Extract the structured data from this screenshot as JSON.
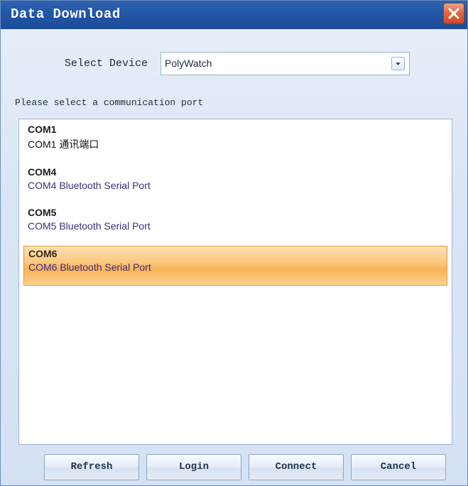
{
  "window": {
    "title": "Data Download"
  },
  "device": {
    "label": "Select Device",
    "selected": "PolyWatch"
  },
  "ports": {
    "prompt": "Please select a communication port",
    "items": [
      {
        "name": "COM1",
        "description": "COM1 通讯端口",
        "selected": false
      },
      {
        "name": "COM4",
        "description": "COM4 Bluetooth Serial Port",
        "selected": false
      },
      {
        "name": "COM5",
        "description": "COM5 Bluetooth Serial Port",
        "selected": false
      },
      {
        "name": "COM6",
        "description": "COM6 Bluetooth Serial Port",
        "selected": true
      }
    ]
  },
  "buttons": {
    "refresh": "Refresh",
    "login": "Login",
    "connect": "Connect",
    "cancel": "Cancel"
  },
  "colors": {
    "titlebar": "#2256a6",
    "close": "#e26a44",
    "selection": "#f7b357"
  },
  "icons": {
    "close": "close-icon",
    "dropdown": "chevron-down-icon"
  }
}
